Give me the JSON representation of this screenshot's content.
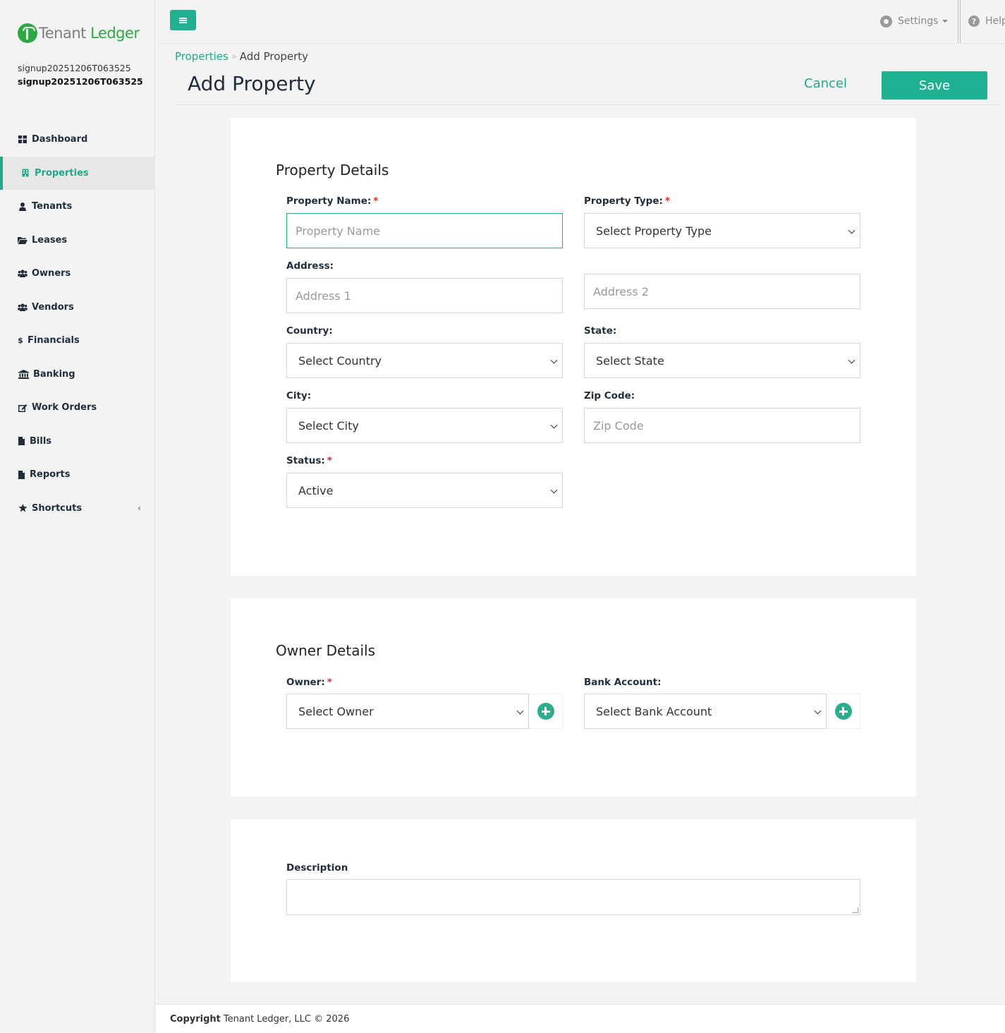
{
  "brand": {
    "name_part1": "Tenant",
    "name_part2": "Ledger"
  },
  "user": {
    "line1": "signup20251206T063525",
    "line2": "signup20251206T063525"
  },
  "sidebar": {
    "items": [
      {
        "label": "Dashboard",
        "icon": "dashboard-icon"
      },
      {
        "label": "Properties",
        "icon": "building-icon"
      },
      {
        "label": "Tenants",
        "icon": "user-icon"
      },
      {
        "label": "Leases",
        "icon": "folder-icon"
      },
      {
        "label": "Owners",
        "icon": "users-icon"
      },
      {
        "label": "Vendors",
        "icon": "users-icon"
      },
      {
        "label": "Financials",
        "icon": "dollar-icon"
      },
      {
        "label": "Banking",
        "icon": "bank-icon"
      },
      {
        "label": "Work Orders",
        "icon": "edit-icon"
      },
      {
        "label": "Bills",
        "icon": "file-icon"
      },
      {
        "label": "Reports",
        "icon": "file-icon"
      },
      {
        "label": "Shortcuts",
        "icon": "star-icon"
      }
    ],
    "active": "Properties"
  },
  "topbar": {
    "settings_label": "Settings",
    "help_label": "Help"
  },
  "breadcrumb": {
    "parent": "Properties",
    "separator": "»",
    "current": "Add Property"
  },
  "page": {
    "title": "Add Property",
    "cancel_label": "Cancel",
    "save_label": "Save"
  },
  "property_details": {
    "title": "Property Details",
    "property_name": {
      "label": "Property Name:",
      "placeholder": "Property Name",
      "required": "*"
    },
    "property_type": {
      "label": "Property Type:",
      "value": "Select Property Type",
      "required": "*"
    },
    "address": {
      "label": "Address:",
      "placeholder1": "Address 1",
      "placeholder2": "Address 2"
    },
    "country": {
      "label": "Country:",
      "value": "Select Country"
    },
    "state": {
      "label": "State:",
      "value": "Select State"
    },
    "city": {
      "label": "City:",
      "value": "Select City"
    },
    "zip": {
      "label": "Zip Code:",
      "placeholder": "Zip Code"
    },
    "status": {
      "label": "Status:",
      "value": "Active",
      "required": "*"
    }
  },
  "owner_details": {
    "title": "Owner Details",
    "owner": {
      "label": "Owner:",
      "value": "Select Owner",
      "required": "*"
    },
    "bank_account": {
      "label": "Bank Account:",
      "value": "Select Bank Account"
    }
  },
  "description": {
    "label": "Description"
  },
  "footer": {
    "copyright_label": "Copyright",
    "text": "Tenant Ledger, LLC © 2026"
  },
  "colors": {
    "accent": "#20b092",
    "brand_green": "#2ea843",
    "required": "#e0292f"
  }
}
